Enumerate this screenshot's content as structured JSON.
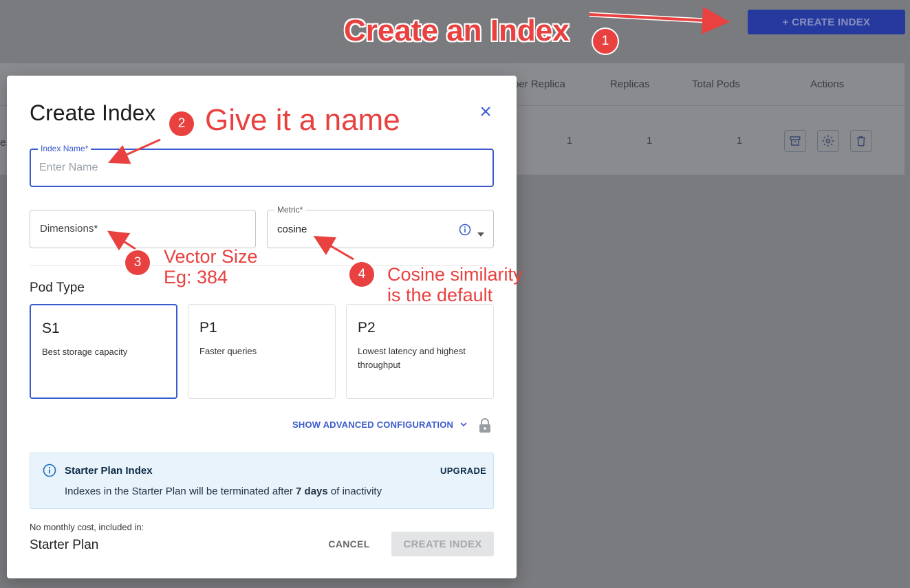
{
  "background": {
    "top_button_label": "+ CREATE INDEX",
    "table_headers": [
      "per Replica",
      "Replicas",
      "Total Pods",
      "Actions"
    ],
    "row": {
      "truncated": "e.",
      "per_replica": "1",
      "replicas": "1",
      "total_pods": "1"
    },
    "action_icons": [
      "archive-icon",
      "gear-icon",
      "trash-icon"
    ]
  },
  "modal": {
    "title": "Create Index",
    "index_name": {
      "label": "Index Name",
      "required": "*",
      "placeholder": "Enter Name",
      "value": ""
    },
    "dimensions": {
      "label": "Dimensions",
      "required": "*"
    },
    "metric": {
      "label": "Metric",
      "required": "*",
      "value": "cosine"
    },
    "pod_type": {
      "label": "Pod Type",
      "options": [
        {
          "name": "S1",
          "description": "Best storage capacity",
          "selected": true
        },
        {
          "name": "P1",
          "description": "Faster queries",
          "selected": false
        },
        {
          "name": "P2",
          "description": "Lowest latency and highest throughput",
          "selected": false
        }
      ]
    },
    "advanced_label": "SHOW ADVANCED CONFIGURATION",
    "notice": {
      "title": "Starter Plan Index",
      "text_before": "Indexes in the Starter Plan will be terminated after ",
      "text_bold": "7 days",
      "text_after": " of inactivity",
      "upgrade_label": "UPGRADE"
    },
    "cost_label": "No monthly cost, included in:",
    "plan_name": "Starter Plan",
    "cancel_label": "CANCEL",
    "create_label": "CREATE INDEX"
  },
  "annotations": {
    "a1": {
      "num": "1",
      "text": "Create an Index"
    },
    "a2": {
      "num": "2",
      "text": "Give it a name"
    },
    "a3": {
      "num": "3",
      "line1": "Vector Size",
      "line2": "Eg: 384"
    },
    "a4": {
      "num": "4",
      "line1": "Cosine similarity",
      "line2": "is the default"
    }
  },
  "colors": {
    "accent": "#3b5bcc",
    "annotation": "#e8413f",
    "notice_bg": "#e8f3fb"
  }
}
